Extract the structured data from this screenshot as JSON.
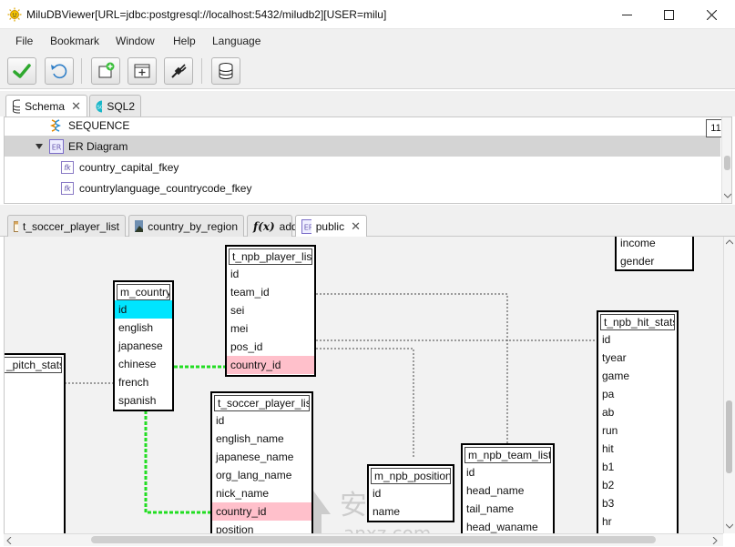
{
  "window": {
    "title": "MiluDBViewer[URL=jdbc:postgresql://localhost:5432/miludb2][USER=milu]"
  },
  "menu": [
    "File",
    "Bookmark",
    "Window",
    "Help",
    "Language"
  ],
  "toolbar": {
    "buttons": [
      "commit-icon",
      "rollback-icon",
      "new-window-icon",
      "new-tab-icon",
      "connect-icon",
      "database-icon"
    ]
  },
  "tabs_top": [
    {
      "label": "Schema",
      "icon": "database-icon",
      "active": true
    },
    {
      "label": "SQL2",
      "icon": "sql-icon",
      "active": false
    }
  ],
  "tree": {
    "badge": "11",
    "rows": [
      {
        "label": "SEQUENCE",
        "icon": "sequence-icon"
      },
      {
        "label": "ER Diagram",
        "icon": "er-icon",
        "expanded": true
      },
      {
        "label": "country_capital_fkey",
        "icon": "fk-icon"
      },
      {
        "label": "countrylanguage_countrycode_fkey",
        "icon": "fk-icon"
      }
    ]
  },
  "tabs_bottom": [
    {
      "label": "t_soccer_player_list",
      "icon": "table-icon"
    },
    {
      "label": "country_by_region",
      "icon": "view-icon"
    },
    {
      "label": "add",
      "icon": "function-icon"
    },
    {
      "label": "public",
      "icon": "er-icon",
      "active": true
    }
  ],
  "diagram": {
    "tables": {
      "pitch_stats": {
        "name": "_pitch_stats",
        "columns": []
      },
      "m_country": {
        "name": "m_country",
        "columns": [
          "id",
          "english",
          "japanese",
          "chinese",
          "french",
          "spanish"
        ]
      },
      "t_npb_player_list": {
        "name": "t_npb_player_list",
        "columns": [
          "id",
          "team_id",
          "sei",
          "mei",
          "pos_id",
          "country_id"
        ]
      },
      "t_soccer_player_list": {
        "name": "t_soccer_player_list",
        "columns": [
          "id",
          "english_name",
          "japanese_name",
          "org_lang_name",
          "nick_name",
          "country_id",
          "position"
        ]
      },
      "m_npb_position": {
        "name": "m_npb_position",
        "columns": [
          "id",
          "name"
        ]
      },
      "m_npb_team_list": {
        "name": "m_npb_team_list",
        "columns": [
          "id",
          "head_name",
          "tail_name",
          "head_waname"
        ]
      },
      "t_npb_hit_stats": {
        "name": "t_npb_hit_stats",
        "columns": [
          "id",
          "tyear",
          "game",
          "pa",
          "ab",
          "run",
          "hit",
          "b1",
          "b2",
          "b3",
          "hr"
        ]
      },
      "partial_top_right": {
        "columns": [
          "income",
          "gender"
        ]
      }
    },
    "colors": {
      "highlight_pk": "#00e5ff",
      "highlight_fk": "#ffc0cb",
      "relation_green": "#22dd22"
    },
    "watermark": {
      "text": "安下载",
      "subtext": "anxz.com"
    }
  }
}
